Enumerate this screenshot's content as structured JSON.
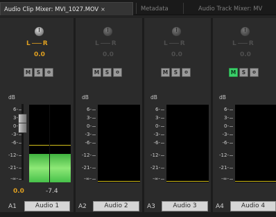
{
  "tabs": [
    {
      "label": "Audio Clip Mixer: MVI_1027.MOV",
      "close": "×",
      "active": true
    },
    {
      "label": "Metadata",
      "active": false
    },
    {
      "label": "Audio Track Mixer: MV",
      "active": false
    }
  ],
  "db_scale": {
    "unit": "dB",
    "ticks": [
      "6-",
      "3-",
      "0-",
      "-3-",
      "-6-",
      "-12-",
      "-21-",
      "-∞-"
    ]
  },
  "tracks": [
    {
      "id": "A1",
      "name": "Audio 1",
      "pan_left": "L",
      "pan_right": "R",
      "pan_value": "0.0",
      "mute": "M",
      "solo": "S",
      "third": "o",
      "volume": "0.0",
      "peak": "-7.4",
      "active_controls": true,
      "meter_level_db": -7.4,
      "meter_fill_fraction": 0.38,
      "mute_on": false
    },
    {
      "id": "A2",
      "name": "Audio 2",
      "pan_left": "L",
      "pan_right": "R",
      "pan_value": "0.0",
      "mute": "M",
      "solo": "S",
      "third": "o",
      "active_controls": false,
      "meter_fill_fraction": 0,
      "mute_on": false
    },
    {
      "id": "A3",
      "name": "Audio 3",
      "pan_left": "L",
      "pan_right": "R",
      "pan_value": "0.0",
      "mute": "M",
      "solo": "S",
      "third": "o",
      "active_controls": false,
      "meter_fill_fraction": 0,
      "mute_on": false
    },
    {
      "id": "A4",
      "name": "Audio 4",
      "pan_left": "L",
      "pan_right": "R",
      "pan_value": "0.0",
      "mute": "M",
      "solo": "S",
      "third": "o",
      "active_controls": false,
      "meter_fill_fraction": 0,
      "mute_on": true
    }
  ],
  "colors": {
    "accent": "#e0a020",
    "meter_green": "#5fd55a",
    "mute_on": "#3ad06a",
    "peak_line": "#d6c21a"
  }
}
